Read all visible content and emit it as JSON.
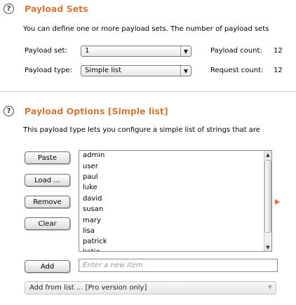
{
  "payload_sets": {
    "help_icon": "?",
    "title": "Payload Sets",
    "description": "You can define one or more payload sets. The number of payload sets",
    "set_label": "Payload set:",
    "set_value": "1",
    "type_label": "Payload type:",
    "type_value": "Simple list",
    "payload_count_label": "Payload count:",
    "payload_count": "12",
    "request_count_label": "Request count:",
    "request_count": "12",
    "dropdown_arrow": "▼"
  },
  "payload_options": {
    "help_icon": "?",
    "title": "Payload Options [Simple list]",
    "description": "This payload type lets you configure a simple list of strings that are",
    "buttons": {
      "paste": "Paste",
      "load": "Load ...",
      "remove": "Remove",
      "clear": "Clear",
      "add": "Add"
    },
    "list_items": [
      "admin",
      "user",
      "paul",
      "luke",
      "david",
      "susan",
      "mary",
      "lisa",
      "patrick",
      "katie"
    ],
    "scroll_up": "▲",
    "scroll_down": "▼",
    "new_item_placeholder": "Enter a new item",
    "add_from_list": "Add from list ... [Pro version only]",
    "add_from_list_arrow": "▼"
  },
  "colors": {
    "section_title": "#d07838",
    "side_arrow": "#e06a3a"
  }
}
